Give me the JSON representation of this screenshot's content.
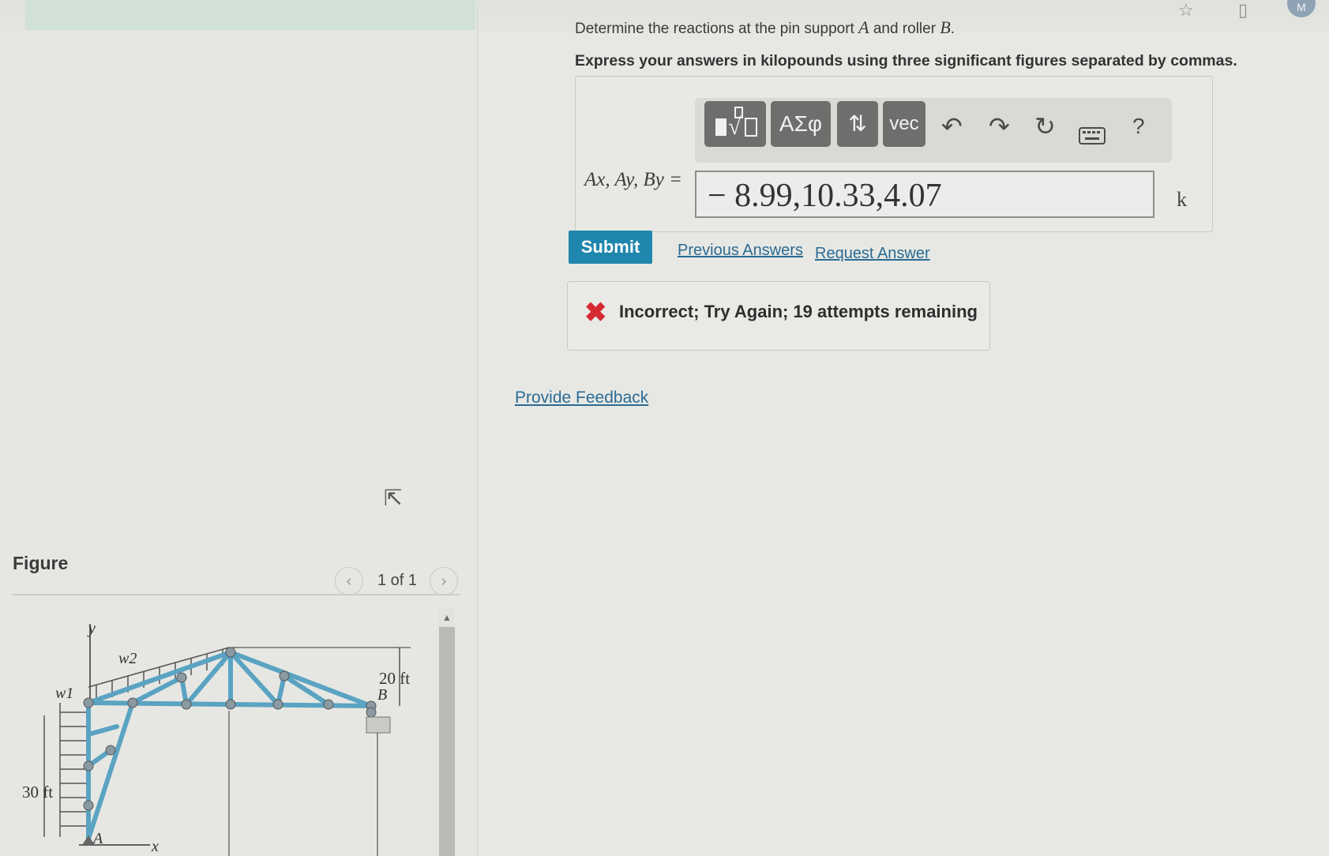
{
  "question": {
    "prefix": "Determine the reactions at the pin support ",
    "var_a": "A",
    "middle": " and roller ",
    "var_b": "B",
    "suffix": "."
  },
  "instruction": "Express your answers in kilopounds using three significant figures separated by commas.",
  "toolbar": {
    "template_icon": "template-sqrt-icon",
    "greek_label": "ΑΣφ",
    "arrows_label": "⇅",
    "vec_label": "vec",
    "undo_icon": "undo-icon",
    "redo_icon": "redo-icon",
    "reset_icon": "reset-icon",
    "keyboard_icon": "keyboard-icon",
    "help_label": "?"
  },
  "answer": {
    "label": "Ax, Ay, By =",
    "value": "− 8.99,10.33,4.07",
    "unit": "k"
  },
  "actions": {
    "submit": "Submit",
    "previous_answers": "Previous Answers",
    "request_answer": "Request Answer"
  },
  "feedback": {
    "icon": "incorrect-x-icon",
    "message": "Incorrect; Try Again; 19 attempts remaining"
  },
  "provide_feedback": "Provide Feedback",
  "figure": {
    "heading": "Figure",
    "pager": "1 of 1",
    "labels": {
      "y": "y",
      "x": "x",
      "w1": "w1",
      "w2": "w2",
      "height_left": "30 ft",
      "height_right": "20 ft",
      "point_a": "A",
      "point_b": "B"
    }
  },
  "colors": {
    "submit": "#1f86ad",
    "link": "#2a6b93",
    "error": "#d62a33",
    "truss": "#5aa3c2"
  }
}
